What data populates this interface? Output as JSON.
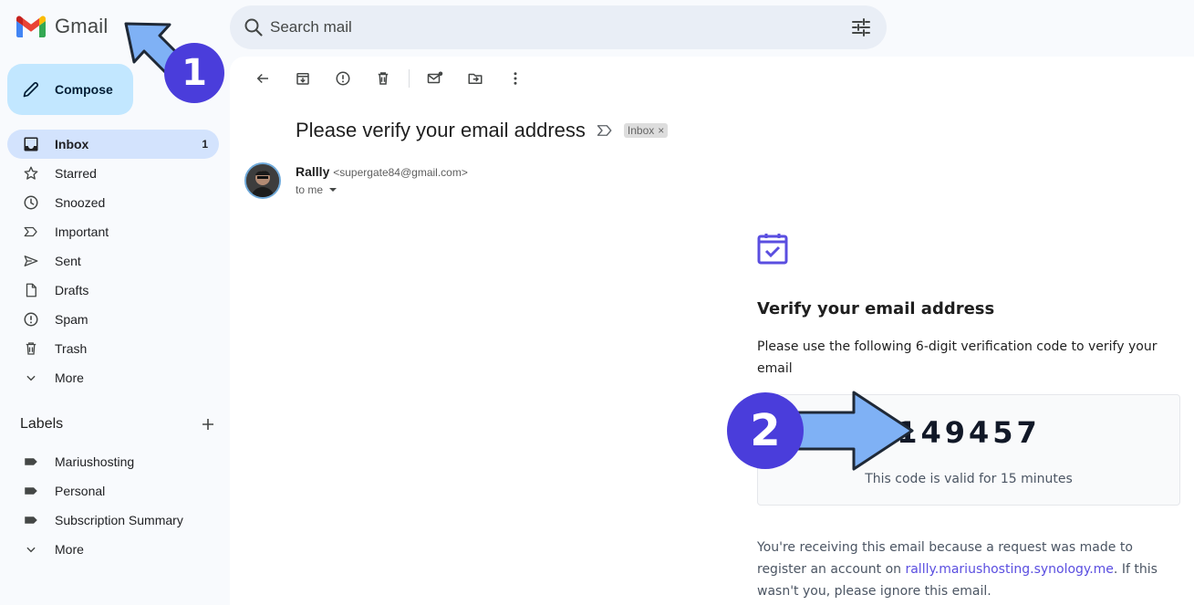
{
  "header": {
    "app_name": "Gmail",
    "search_placeholder": "Search mail"
  },
  "sidebar": {
    "compose_label": "Compose",
    "items": [
      {
        "label": "Inbox",
        "count": "1",
        "icon": "inbox-icon"
      },
      {
        "label": "Starred",
        "icon": "star-icon"
      },
      {
        "label": "Snoozed",
        "icon": "clock-icon"
      },
      {
        "label": "Important",
        "icon": "important-icon"
      },
      {
        "label": "Sent",
        "icon": "send-icon"
      },
      {
        "label": "Drafts",
        "icon": "draft-icon"
      },
      {
        "label": "Spam",
        "icon": "spam-icon"
      },
      {
        "label": "Trash",
        "icon": "trash-icon"
      },
      {
        "label": "More",
        "icon": "chevron-down-icon"
      }
    ],
    "labels_heading": "Labels",
    "labels": [
      {
        "label": "Mariushosting",
        "icon": "label-icon"
      },
      {
        "label": "Personal",
        "icon": "label-icon"
      },
      {
        "label": "Subscription Summary",
        "icon": "label-icon"
      },
      {
        "label": "More",
        "icon": "chevron-down-icon"
      }
    ]
  },
  "message": {
    "subject": "Please verify your email address",
    "chip": "Inbox",
    "sender_name": "Rallly",
    "sender_email": "<supergate84@gmail.com>",
    "to": "to me"
  },
  "email_body": {
    "title": "Verify your email address",
    "instruction": "Please use the following 6-digit verification code to verify your email",
    "code": "149457",
    "validity": "This code is valid for 15 minutes",
    "footer_before": "You're receiving this email because a request was made to register an account on ",
    "footer_link": "rallly.mariushosting.synology.me",
    "footer_after": ". If this wasn't you, please ignore this email."
  },
  "annotations": {
    "step1": "1",
    "step2": "2"
  },
  "colors": {
    "accent": "#4a3ddb",
    "arrow_fill": "#7fb1f5",
    "compose_bg": "#c2e7ff",
    "active_nav": "#d3e3fd"
  }
}
